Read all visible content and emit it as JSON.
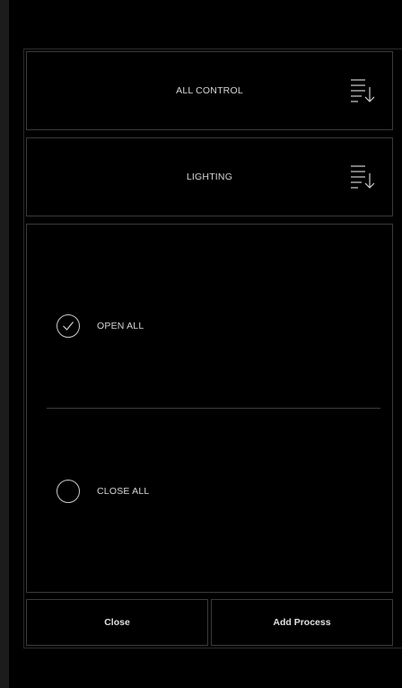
{
  "dropdowns": [
    {
      "label": "ALL CONTROL",
      "icon": "sort-list-icon"
    },
    {
      "label": "LIGHTING",
      "icon": "sort-list-icon"
    }
  ],
  "options": [
    {
      "label": "OPEN ALL",
      "selected": true
    },
    {
      "label": "CLOSE ALL",
      "selected": false
    }
  ],
  "footer": {
    "close_label": "Close",
    "add_label": "Add Process"
  },
  "colors": {
    "background": "#000000",
    "border": "#3a3a3a",
    "text": "#d6d6d6"
  }
}
